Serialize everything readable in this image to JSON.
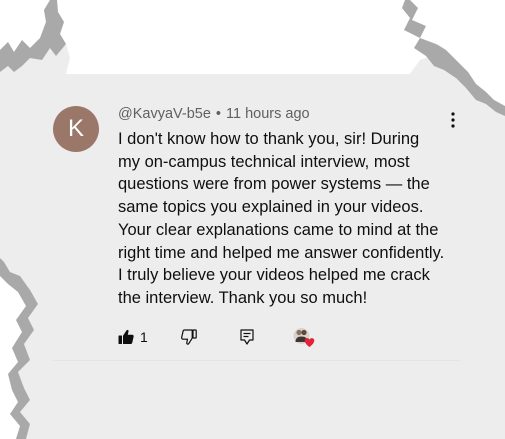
{
  "colors": {
    "background": "#ededed",
    "avatar_bg": "#9a7768",
    "text_primary": "#0f0f0f",
    "text_secondary": "#606060",
    "heart": "#e0243b",
    "torn_edge": "#a9a9a9"
  },
  "comment": {
    "avatar_letter": "K",
    "author": "@KavyaV-b5e",
    "separator": "•",
    "timestamp": "11 hours ago",
    "more_icon": "vertical-ellipsis-icon",
    "lines": [
      "I don't know how to thank you, sir! During",
      "my on-campus technical interview, most",
      "questions were from power systems — the",
      "same topics you explained in your videos.",
      "Your clear explanations came to mind at the",
      "right time and helped me answer confidently.",
      "I truly believe your videos helped me crack",
      "the interview. Thank you so much!"
    ],
    "actions": {
      "like_icon": "thumbs-up-filled-icon",
      "like_count": "1",
      "dislike_icon": "thumbs-down-outline-icon",
      "reply_icon": "reply-comment-icon",
      "creator_heart_icon": "creator-heart-badge-icon"
    }
  }
}
